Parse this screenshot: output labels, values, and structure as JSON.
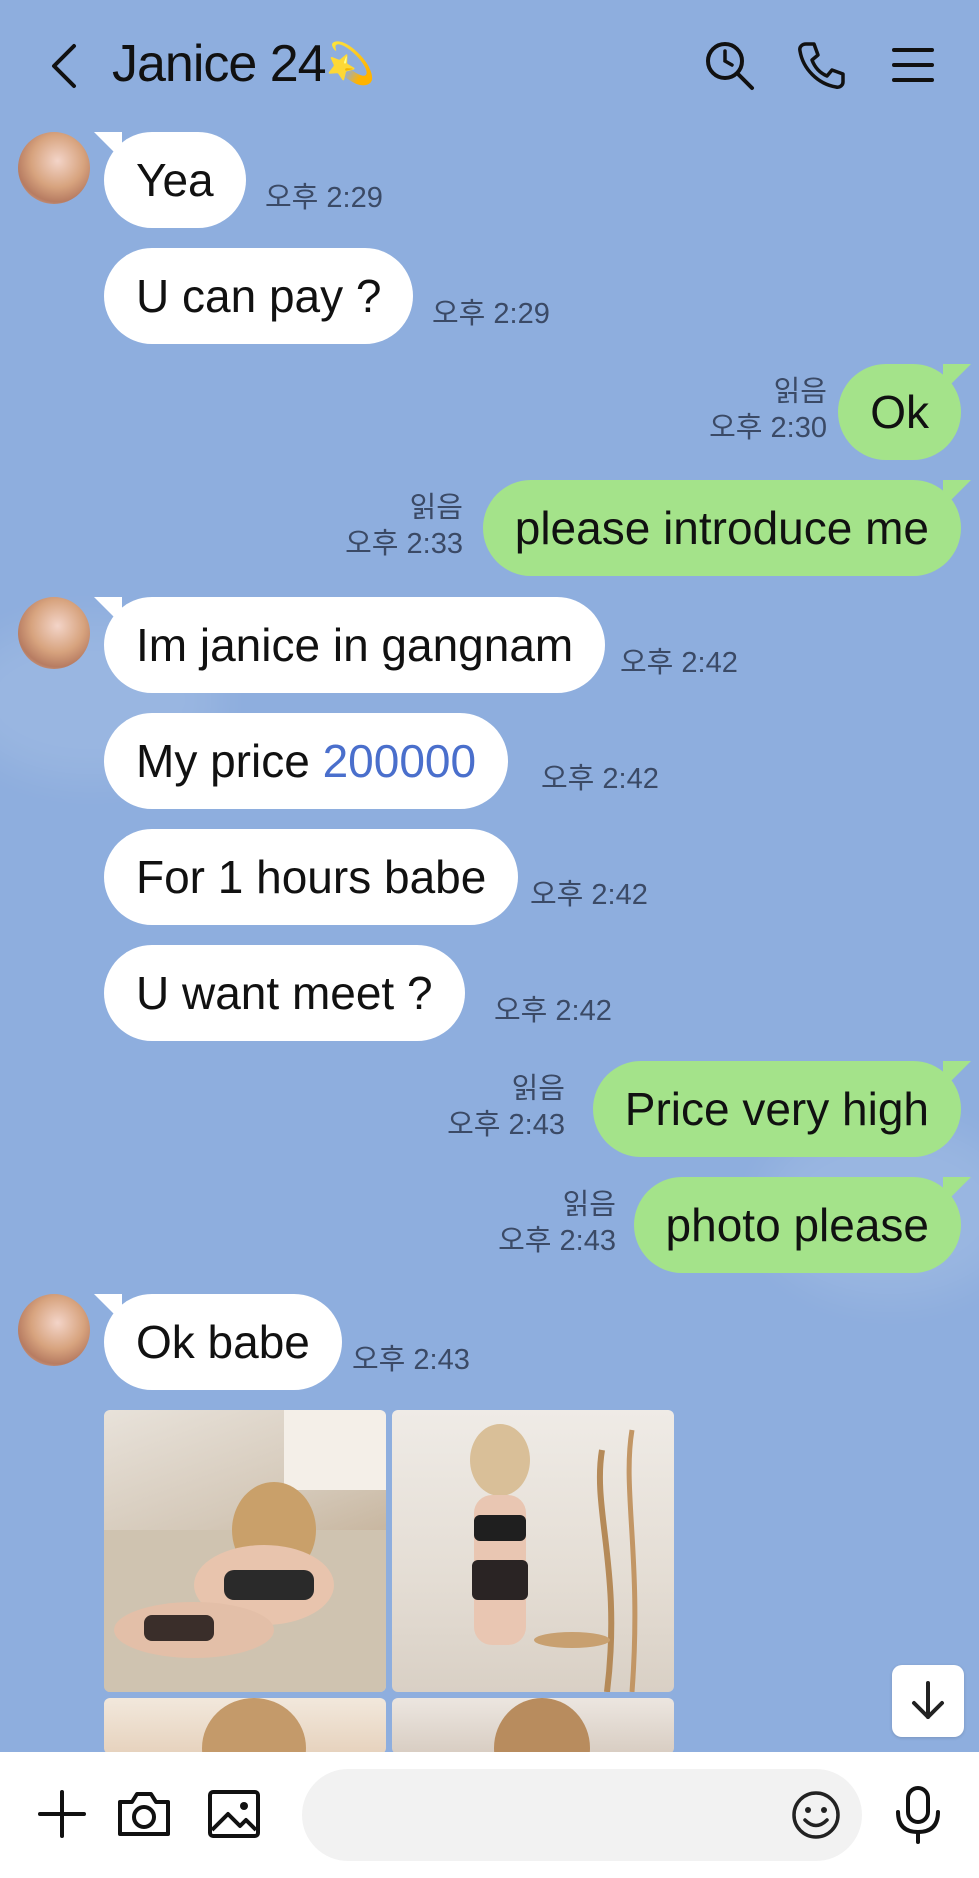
{
  "header": {
    "back_label": "back",
    "title": "Janice 24",
    "title_emoji": "💫"
  },
  "messages": [
    {
      "side": "in",
      "text": "Yea",
      "time": "오후 2:29"
    },
    {
      "side": "in",
      "text": "U can pay ?",
      "time": "오후 2:29"
    },
    {
      "side": "out",
      "text": "Ok",
      "read": "읽음",
      "time": "오후 2:30"
    },
    {
      "side": "out",
      "text": "please introduce me",
      "read": "읽음",
      "time": "오후 2:33"
    },
    {
      "side": "in",
      "text": "Im janice in gangnam",
      "time": "오후 2:42"
    },
    {
      "side": "in",
      "text_prefix": "My price ",
      "text_number": "200000",
      "time": "오후 2:42"
    },
    {
      "side": "in",
      "text": "For 1 hours babe",
      "time": "오후 2:42"
    },
    {
      "side": "in",
      "text": "U want meet ?",
      "time": "오후 2:42"
    },
    {
      "side": "out",
      "text": "Price very high",
      "read": "읽음",
      "time": "오후 2:43"
    },
    {
      "side": "out",
      "text": "photo please",
      "read": "읽음",
      "time": "오후 2:43"
    },
    {
      "side": "in",
      "text": "Ok babe",
      "time": "오후 2:43"
    }
  ],
  "icons": {
    "search": "search-clock-icon",
    "call": "phone-icon",
    "menu": "menu-icon",
    "scroll_down": "arrow-down-icon",
    "add": "plus-icon",
    "camera": "camera-icon",
    "gallery": "image-icon",
    "emoji": "smiley-icon",
    "mic": "microphone-icon"
  },
  "colors": {
    "background": "#8eaede",
    "outgoing_bubble": "#a4e38a",
    "incoming_bubble": "#ffffff",
    "number_link": "#4a6fcc"
  }
}
